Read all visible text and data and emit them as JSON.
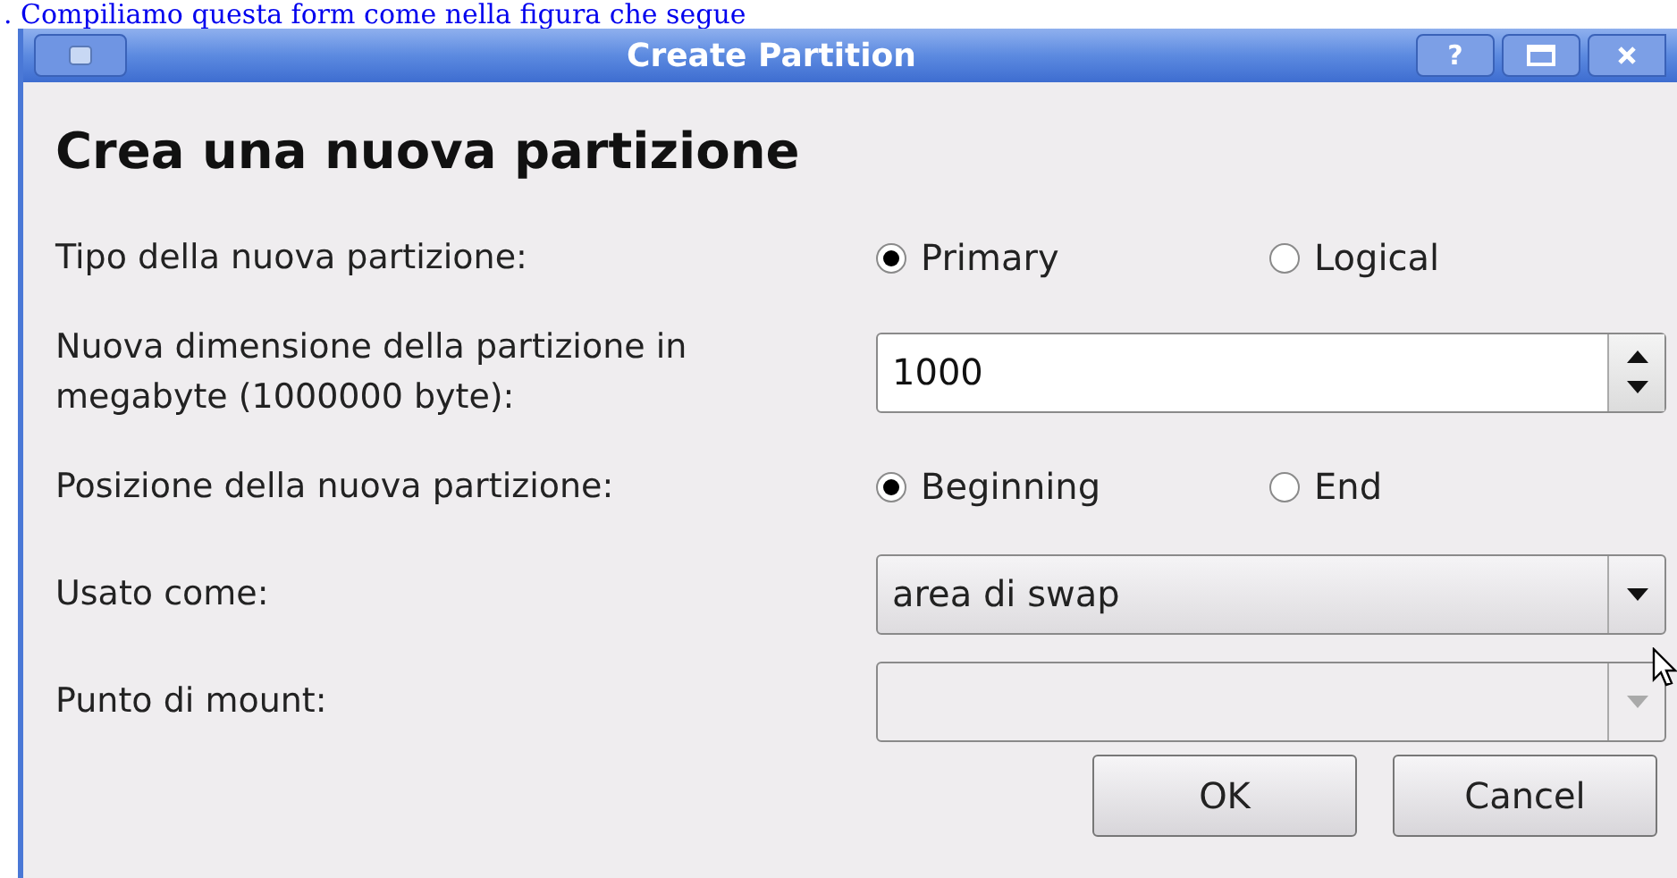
{
  "caption": ". Compiliamo questa form come nella figura che segue",
  "window": {
    "title": "Create Partition",
    "controls": [
      "?"
    ]
  },
  "heading": "Crea una nuova partizione",
  "rows": [
    {
      "kind": "radio",
      "label": "Tipo della nuova partizione:",
      "options": [
        {
          "label": "Primary",
          "selected": true
        },
        {
          "label": "Logical",
          "selected": false
        }
      ]
    },
    {
      "kind": "spin",
      "label": "Nuova dimensione della partizione in megabyte (1000000 byte):",
      "value": "1000"
    },
    {
      "kind": "radio",
      "label": "Posizione della nuova partizione:",
      "options": [
        {
          "label": "Beginning",
          "selected": true
        },
        {
          "label": "End",
          "selected": false
        }
      ]
    },
    {
      "kind": "combo",
      "label": "Usato come:",
      "value": "area di swap",
      "disabled": false
    },
    {
      "kind": "combo",
      "label": "Punto di mount:",
      "disabled": true
    }
  ],
  "buttons": [
    "OK",
    "Cancel"
  ]
}
